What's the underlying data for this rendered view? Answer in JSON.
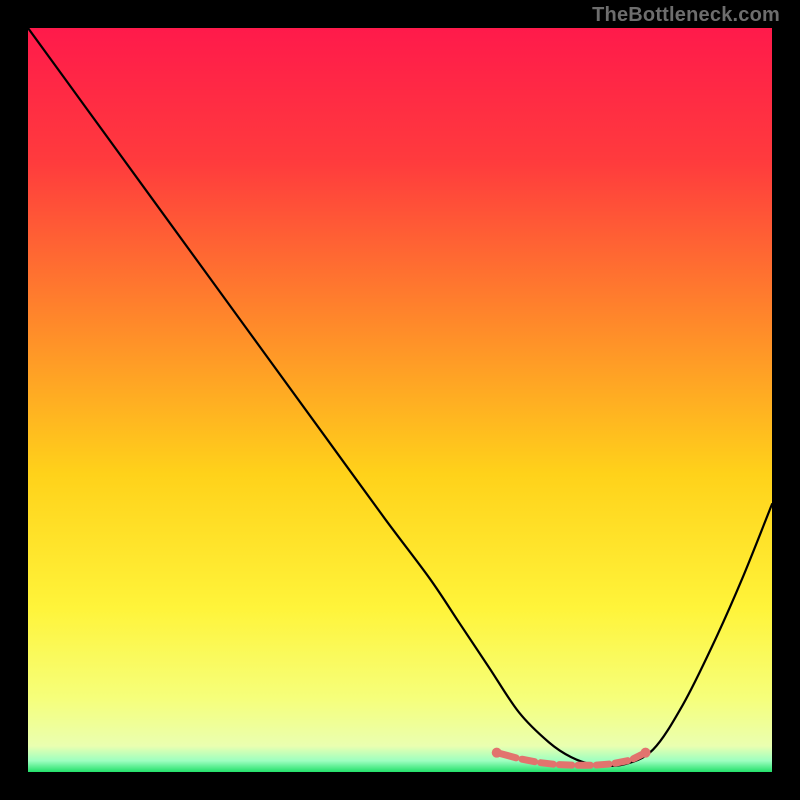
{
  "attribution": "TheBottleneck.com",
  "chart_data": {
    "type": "line",
    "title": "",
    "xlabel": "",
    "ylabel": "",
    "xlim": [
      0,
      100
    ],
    "ylim": [
      0,
      100
    ],
    "gradient_stops": [
      {
        "offset": 0.0,
        "color": "#ff1a4b"
      },
      {
        "offset": 0.18,
        "color": "#ff3b3d"
      },
      {
        "offset": 0.4,
        "color": "#ff8a2a"
      },
      {
        "offset": 0.6,
        "color": "#ffd21a"
      },
      {
        "offset": 0.78,
        "color": "#fff43a"
      },
      {
        "offset": 0.9,
        "color": "#f6ff7a"
      },
      {
        "offset": 0.965,
        "color": "#eaffb0"
      },
      {
        "offset": 0.985,
        "color": "#9dffc0"
      },
      {
        "offset": 1.0,
        "color": "#22e06a"
      }
    ],
    "series": [
      {
        "name": "bottleneck-curve",
        "x": [
          0,
          8,
          16,
          24,
          32,
          40,
          48,
          54,
          58,
          62,
          66,
          70,
          73,
          76,
          80,
          84,
          88,
          92,
          96,
          100
        ],
        "values": [
          100,
          89,
          78,
          67,
          56,
          45,
          34,
          26,
          20,
          14,
          8,
          4,
          2,
          1,
          1,
          3,
          9,
          17,
          26,
          36
        ]
      }
    ],
    "markers": {
      "name": "highlight-band",
      "color": "#e2736e",
      "x": [
        63,
        66,
        68.5,
        71,
        73.5,
        76,
        78.5,
        81,
        83
      ],
      "values": [
        2.6,
        1.8,
        1.3,
        1.0,
        0.9,
        0.9,
        1.1,
        1.6,
        2.6
      ]
    }
  }
}
